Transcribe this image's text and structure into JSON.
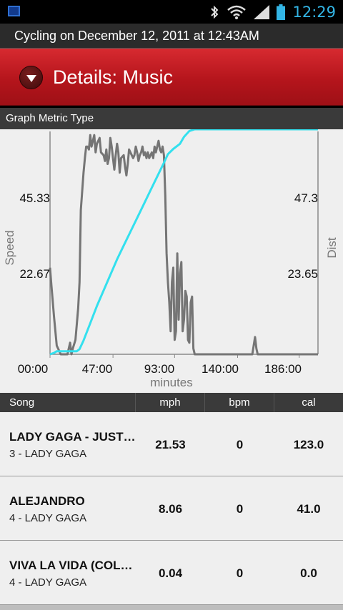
{
  "status_bar": {
    "time": "12:29",
    "icons": [
      "notification-icon",
      "bluetooth-icon",
      "wifi-icon",
      "signal-icon",
      "battery-icon"
    ]
  },
  "title_bar": {
    "text": "Cycling on December 12, 2011 at 12:43AM"
  },
  "section": {
    "title": "Details: Music"
  },
  "metric_bar": {
    "label": "Graph Metric Type"
  },
  "graph": {
    "left_axis_label": "Speed",
    "right_axis_label": "Dist",
    "x_axis_label": "minutes",
    "left_ticks": [
      "45.33",
      "22.67"
    ],
    "right_ticks": [
      "47.3",
      "23.65"
    ],
    "x_ticks": [
      "00:00",
      "47:00",
      "93:00",
      "140:00",
      "186:00"
    ],
    "colors": {
      "speed": "#757575",
      "distance": "#33e0ee",
      "axis": "#8a8a8a"
    }
  },
  "chart_data": {
    "type": "line",
    "xlabel": "minutes",
    "x_ticks": [
      "00:00",
      "47:00",
      "93:00",
      "140:00",
      "186:00"
    ],
    "series": [
      {
        "name": "Speed",
        "axis": "left",
        "points": [
          [
            0,
            30
          ],
          [
            1,
            24
          ],
          [
            3,
            13
          ],
          [
            5,
            3
          ],
          [
            8,
            0
          ],
          [
            13,
            0
          ],
          [
            15,
            4
          ],
          [
            16,
            0
          ],
          [
            17,
            2
          ],
          [
            19,
            5
          ],
          [
            21,
            16
          ],
          [
            22,
            25
          ],
          [
            23,
            50
          ],
          [
            25,
            63
          ],
          [
            26,
            68
          ],
          [
            27,
            72
          ],
          [
            28,
            72
          ],
          [
            29,
            71
          ],
          [
            30,
            76
          ],
          [
            31,
            72
          ],
          [
            32,
            74
          ],
          [
            33,
            76
          ],
          [
            34,
            70
          ],
          [
            35,
            73
          ],
          [
            37,
            75
          ],
          [
            38,
            70
          ],
          [
            40,
            69
          ],
          [
            41,
            67
          ],
          [
            42,
            71
          ],
          [
            43,
            66
          ],
          [
            44,
            68
          ],
          [
            45,
            75
          ],
          [
            46,
            72
          ],
          [
            47,
            68
          ],
          [
            48,
            64
          ],
          [
            49,
            69
          ],
          [
            50,
            73
          ],
          [
            51,
            70
          ],
          [
            52,
            63
          ],
          [
            53,
            68
          ],
          [
            55,
            69
          ],
          [
            56,
            65
          ],
          [
            57,
            62
          ],
          [
            58,
            66
          ],
          [
            59,
            71
          ],
          [
            60,
            70
          ],
          [
            62,
            68
          ],
          [
            63,
            69
          ],
          [
            64,
            72
          ],
          [
            65,
            70
          ],
          [
            66,
            67
          ],
          [
            67,
            69
          ],
          [
            68,
            70
          ],
          [
            69,
            72
          ],
          [
            70,
            69
          ],
          [
            71,
            70
          ],
          [
            72,
            68
          ],
          [
            73,
            70
          ],
          [
            74,
            68
          ],
          [
            75,
            69
          ],
          [
            76,
            70
          ],
          [
            77,
            68
          ],
          [
            78,
            72
          ],
          [
            79,
            70
          ],
          [
            80,
            72
          ],
          [
            81,
            74
          ],
          [
            82,
            71
          ],
          [
            83,
            70
          ],
          [
            84,
            72
          ],
          [
            85,
            69
          ],
          [
            86,
            55
          ],
          [
            87,
            35
          ],
          [
            88,
            25
          ],
          [
            89,
            18
          ],
          [
            90,
            8
          ],
          [
            91,
            25
          ],
          [
            92,
            30
          ],
          [
            93,
            5
          ],
          [
            94,
            8
          ],
          [
            95,
            35
          ],
          [
            96,
            12
          ],
          [
            97,
            28
          ],
          [
            98,
            32
          ],
          [
            99,
            8
          ],
          [
            100,
            12
          ],
          [
            101,
            22
          ],
          [
            102,
            20
          ],
          [
            103,
            5
          ],
          [
            104,
            4
          ],
          [
            105,
            18
          ],
          [
            106,
            20
          ],
          [
            107,
            2
          ],
          [
            108,
            0
          ],
          [
            110,
            0
          ],
          [
            150,
            0
          ],
          [
            151,
            0
          ],
          [
            152,
            3
          ],
          [
            153,
            6
          ],
          [
            154,
            2
          ],
          [
            155,
            0
          ],
          [
            200,
            0
          ]
        ]
      },
      {
        "name": "Dist",
        "axis": "right",
        "points": [
          [
            0,
            0
          ],
          [
            3,
            0.4
          ],
          [
            5,
            0.9
          ],
          [
            20,
            0.9
          ],
          [
            22,
            1.5
          ],
          [
            25,
            4
          ],
          [
            30,
            9
          ],
          [
            35,
            14
          ],
          [
            40,
            18.5
          ],
          [
            45,
            23
          ],
          [
            50,
            27.5
          ],
          [
            55,
            31.5
          ],
          [
            60,
            35.5
          ],
          [
            65,
            39.5
          ],
          [
            70,
            43.5
          ],
          [
            75,
            47.5
          ],
          [
            80,
            51.5
          ],
          [
            85,
            55.5
          ],
          [
            88,
            58
          ],
          [
            92,
            59.5
          ],
          [
            97,
            61
          ],
          [
            100,
            63
          ],
          [
            104,
            64.7
          ],
          [
            108,
            65.2
          ],
          [
            200,
            65.2
          ]
        ]
      }
    ],
    "left_ticks": [
      22.67,
      45.33
    ],
    "right_ticks": [
      23.65,
      47.3
    ]
  },
  "table": {
    "columns": {
      "song": "Song",
      "mph": "mph",
      "bpm": "bpm",
      "cal": "cal"
    },
    "rows": [
      {
        "name": "LADY GAGA - JUST DANCE",
        "artist": "3 - LADY GAGA",
        "mph": "21.53",
        "bpm": "0",
        "cal": "123.0"
      },
      {
        "name": "ALEJANDRO",
        "artist": "4 - LADY GAGA",
        "mph": "8.06",
        "bpm": "0",
        "cal": "41.0"
      },
      {
        "name": "VIVA LA VIDA (COLDPLAY)",
        "artist": "4 - LADY GAGA",
        "mph": "0.04",
        "bpm": "0",
        "cal": "0.0"
      }
    ]
  }
}
